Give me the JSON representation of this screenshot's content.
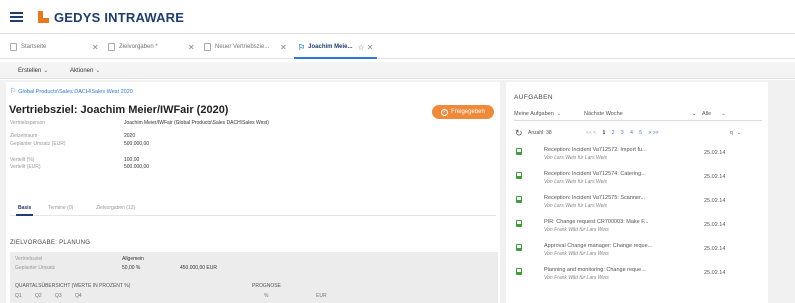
{
  "app": {
    "name": "GEDYS INTRAWARE"
  },
  "tabs": [
    {
      "label": "Startseite"
    },
    {
      "label": "Zielvorgaben *"
    },
    {
      "label": "Neuer Vertriebszie... "
    },
    {
      "label": "Joachim Meie..."
    }
  ],
  "toolbar": {
    "create_label": "Erstellen",
    "actions_label": "Aktionen"
  },
  "record": {
    "breadcrumb": "Global Products\\Sales DACH\\Sales West 2020",
    "title": "Vertriebsziel: Joachim Meier/IWFair (2020)",
    "status_button": "Freigegeben",
    "fields": [
      {
        "label": "Vertriebsperson",
        "value": "Joachim Meier/IWFair (Global Products\\Sales DACH\\Sales West)"
      },
      {
        "label": "Zielzeitraum",
        "value": "2020"
      },
      {
        "label": "Geplanter Umsatz (EUR)",
        "value": "500.000,00"
      },
      {
        "label": "Verteilt (%)",
        "value": "100,00"
      },
      {
        "label": "Verteilt (EUR)",
        "value": "500.000,00"
      }
    ],
    "subtabs": [
      {
        "label": "Basis"
      },
      {
        "label": "Termine (0)"
      },
      {
        "label": "Zielvorgaben (12)"
      }
    ]
  },
  "planung": {
    "section_title": "ZIELVORGABE: PLANUNG",
    "row1_label": "Vertriebsziel",
    "row1_value": "Allgemein",
    "row2_label": "Geplanter Umsatz",
    "row2_percent": "50,00 %",
    "row2_amount": "450.000,00 EUR",
    "quarter_header": "QUARTALSÜBERSICHT (WERTE IN PROZENT %)",
    "quarters": [
      "Q1",
      "Q2",
      "Q3",
      "Q4"
    ],
    "prognose_header": "PROGNOSE",
    "prognose_cols": [
      "%",
      "EUR"
    ]
  },
  "tasks_panel": {
    "title": "AUFGABEN",
    "filter_owner": "Meine Aufgaben",
    "filter_period": "Nächste Woche",
    "filter_all": "Alle",
    "count_label": "Anzahl: 38",
    "pager": [
      "<< <",
      "1",
      "2",
      "3",
      "4",
      "5",
      "> >>"
    ],
    "sort_label": "q",
    "items": [
      {
        "title": "Reception: Incident Va712572: Import fu...",
        "sub": "Von Lars Weis für Lars Weis",
        "date": "25.02.14"
      },
      {
        "title": "Reception: Incident Va712574: Catering...",
        "sub": "Von Lars Weis für Lars Weis",
        "date": "25.02.14"
      },
      {
        "title": "Reception: Incident Va712575: Scanner...",
        "sub": "Von Lars Weis für Lars Weis",
        "date": "25.02.14"
      },
      {
        "title": "PIR: Change request CR700003: Make F...",
        "sub": "Von Frank Wild für Lars Weis",
        "date": "25.02.14"
      },
      {
        "title": "Approval Change manager: Change reque...",
        "sub": "Von Frank Wild für Lars Weis",
        "date": "25.02.14"
      },
      {
        "title": "Planning and monitoring: Change reque...",
        "sub": "Von Frank Wild für Lars Weis",
        "date": "25.02.14"
      }
    ]
  }
}
